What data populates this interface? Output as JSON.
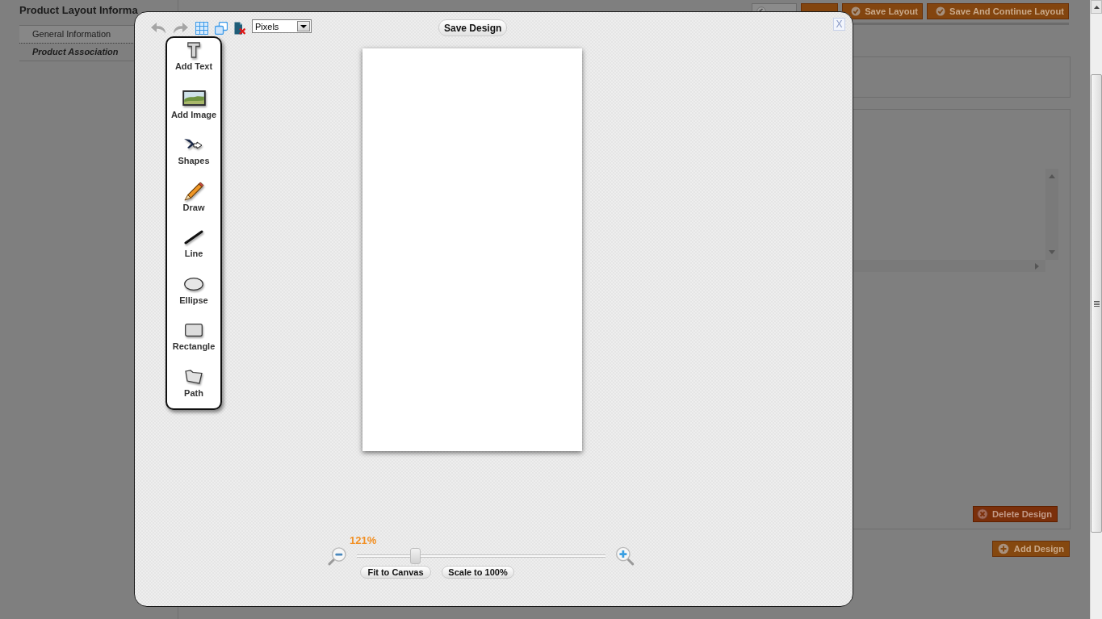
{
  "page": {
    "title": "Product Layout Informa",
    "tabs": [
      {
        "label": "General Information",
        "selected": false
      },
      {
        "label": "Product Association",
        "selected": true
      }
    ],
    "actions": [
      {
        "kind": "back"
      },
      {
        "kind": "reset"
      },
      {
        "kind": "save",
        "label": "Save Layout"
      },
      {
        "kind": "save",
        "label": "Save And Continue Layout"
      }
    ],
    "delete_button": "Delete Design",
    "add_button": "Add Design"
  },
  "dialog": {
    "toolbar": [
      {
        "kind": "undo",
        "disabled": true
      },
      {
        "kind": "redo",
        "disabled": true
      },
      {
        "kind": "grid",
        "disabled": false
      },
      {
        "kind": "arrange",
        "disabled": false
      },
      {
        "kind": "remove",
        "disabled": false
      }
    ],
    "unit_select": {
      "value": "Pixels"
    },
    "save_button": "Save Design",
    "close_button": "X",
    "tools": [
      {
        "kind": "text",
        "label": "Add Text"
      },
      {
        "kind": "image",
        "label": "Add Image"
      },
      {
        "kind": "shapes",
        "label": "Shapes"
      },
      {
        "kind": "draw",
        "label": "Draw"
      },
      {
        "kind": "line",
        "label": "Line"
      },
      {
        "kind": "ellipse",
        "label": "Ellipse"
      },
      {
        "kind": "rectangle",
        "label": "Rectangle"
      },
      {
        "kind": "path",
        "label": "Path"
      }
    ],
    "zoom": {
      "reading": "121%",
      "level": 0.235,
      "fit_button": "Fit to Canvas",
      "scale_button": "Scale to 100%"
    }
  }
}
